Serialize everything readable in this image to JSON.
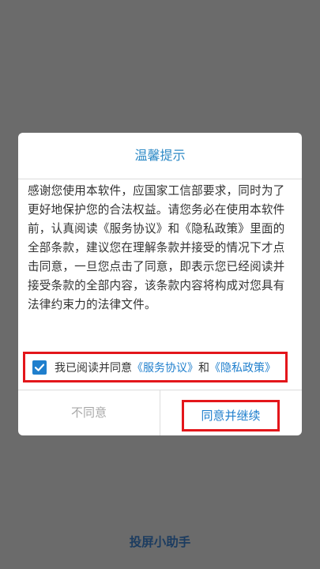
{
  "dialog": {
    "title": "温馨提示",
    "body": "感谢您使用本软件，应国家工信部要求，同时为了更好地保护您的合法权益。请您务必在使用本软件前，认真阅读《服务协议》和《隐私政策》里面的全部条款，建议您在理解条款并接受的情况下才点击同意，一旦您点击了同意，即表示您已经阅读并接受条款的全部内容，该条款内容将构成对您具有法律约束力的法律文件。",
    "consent": {
      "checked": true,
      "prefix": "我已阅读并同意",
      "service_link": "《服务协议》",
      "conjunction": "和",
      "privacy_link": "《隐私政策》"
    },
    "disagree_label": "不同意",
    "agree_label": "同意并继续"
  },
  "app": {
    "name": "投屏小助手"
  },
  "colors": {
    "accent": "#1f7fcd",
    "highlight_border": "#e3161b",
    "backdrop": "#6b6b6b"
  }
}
